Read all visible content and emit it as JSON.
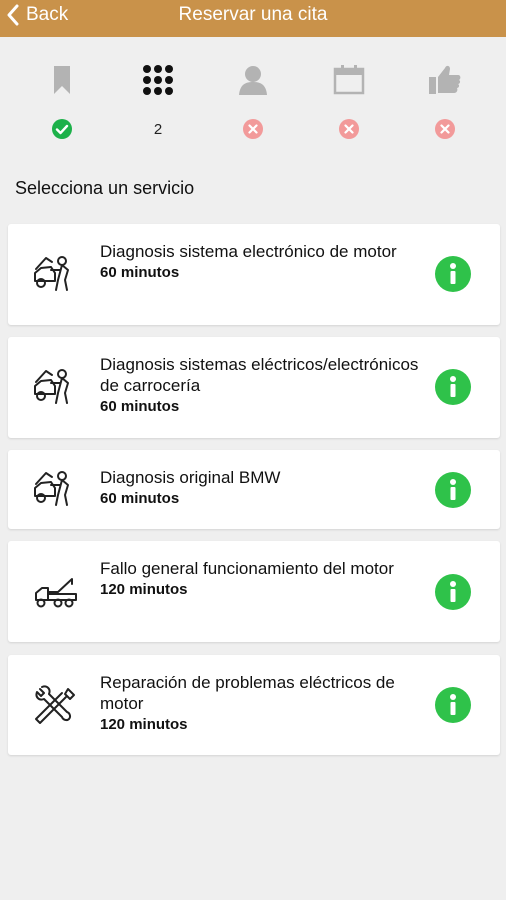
{
  "header": {
    "back_label": "Back",
    "title": "Reservar una cita",
    "bar_color": "#c9924a"
  },
  "steps": [
    {
      "icon": "bookmark-icon",
      "status": "done"
    },
    {
      "icon": "grid-icon",
      "status": "current",
      "number": "2"
    },
    {
      "icon": "person-icon",
      "status": "pending"
    },
    {
      "icon": "calendar-icon",
      "status": "pending"
    },
    {
      "icon": "thumbs-up-icon",
      "status": "pending"
    }
  ],
  "section_title": "Selecciona un servicio",
  "services": [
    {
      "name": "Diagnosis sistema electrónico de motor",
      "duration": "60 minutos",
      "icon": "mechanic-car-icon"
    },
    {
      "name": "Diagnosis sistemas eléctricos/electrónicos de carrocería",
      "duration": "60 minutos",
      "icon": "mechanic-car-icon"
    },
    {
      "name": "Diagnosis original BMW",
      "duration": "60 minutos",
      "icon": "mechanic-car-icon"
    },
    {
      "name": "Fallo general funcionamiento del motor",
      "duration": "120 minutos",
      "icon": "tow-truck-icon"
    },
    {
      "name": "Reparación de problemas eléctricos de motor",
      "duration": "120 minutos",
      "icon": "wrench-screwdriver-icon"
    }
  ],
  "colors": {
    "done": "#1db14a",
    "pending": "#f29a9a",
    "info": "#2fc24a"
  }
}
